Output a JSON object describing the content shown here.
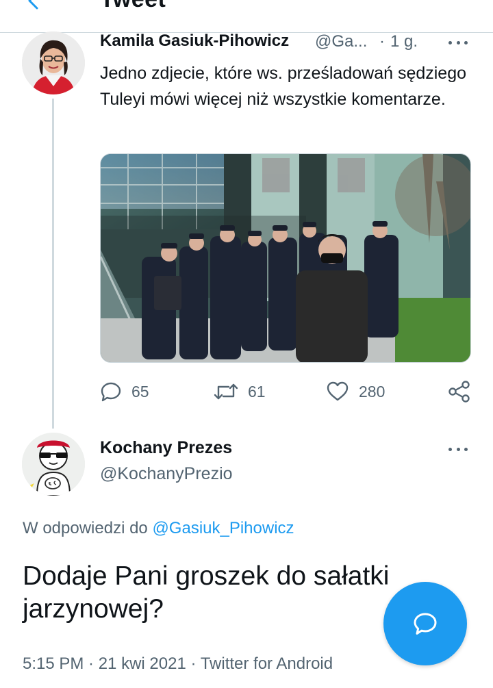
{
  "header": {
    "title": "Tweet"
  },
  "tweet1": {
    "author_name": "Kamila Gasiuk-Pihowicz",
    "handle": "@Ga...",
    "separator": "·",
    "time": "1 g.",
    "text": "Jedno zdjecie, które ws. prześladowań sędziego Tuleyi mówi więcej niż wszystkie komentarze.",
    "stats": {
      "replies": "65",
      "retweets": "61",
      "likes": "280"
    }
  },
  "tweet2": {
    "author_name": "Kochany Prezes",
    "handle": "@KochanyPrezio",
    "reply_prefix": "W odpowiedzi do ",
    "reply_handle": "@Gasiuk_Pihowicz",
    "text": "Dodaje Pani groszek do sałatki jarzynowej?",
    "meta": "5:15 PM · 21 kwi 2021 · Twitter for Android"
  },
  "colors": {
    "accent": "#1d9bf0",
    "muted": "#536471",
    "text": "#0f1419",
    "divider": "#cfd9de"
  },
  "icons": {
    "back": "back-arrow-icon",
    "more": "more-dots-icon",
    "reply": "reply-icon",
    "retweet": "retweet-icon",
    "like": "heart-icon",
    "share": "share-icon",
    "compose": "compose-reply-icon"
  }
}
